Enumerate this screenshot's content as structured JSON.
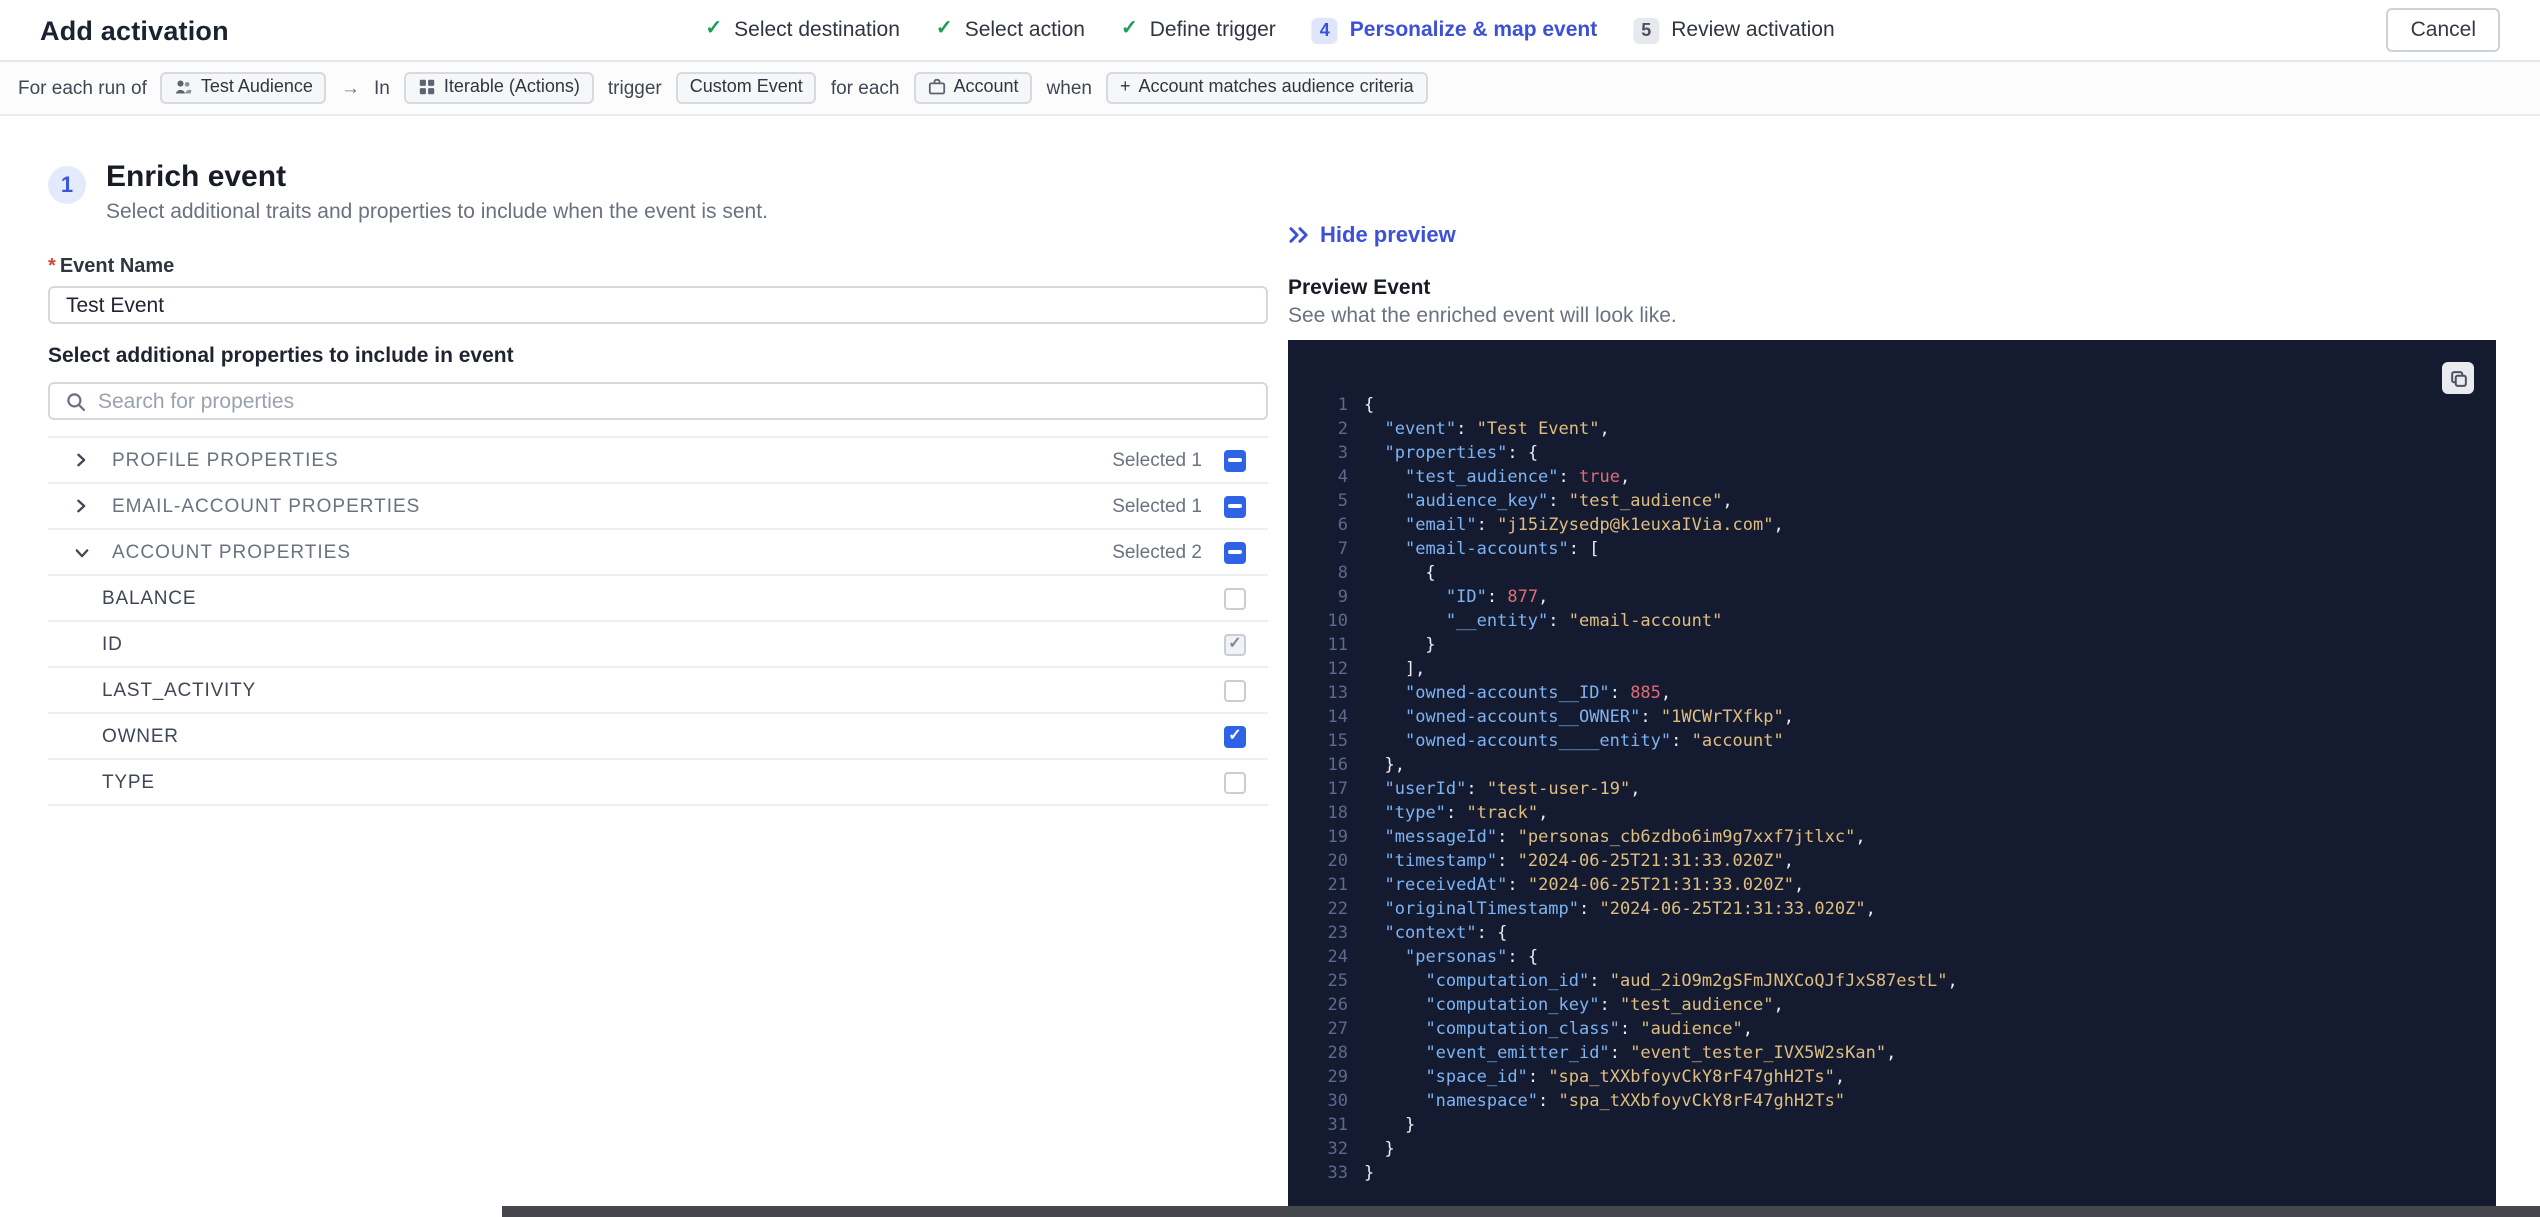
{
  "header": {
    "title": "Add activation",
    "cancel_label": "Cancel",
    "steps": [
      {
        "label": "Select destination",
        "state": "done"
      },
      {
        "label": "Select action",
        "state": "done"
      },
      {
        "label": "Define trigger",
        "state": "done"
      },
      {
        "label": "Personalize & map event",
        "state": "active",
        "number": "4"
      },
      {
        "label": "Review activation",
        "state": "upcoming",
        "number": "5"
      }
    ]
  },
  "context_bar": {
    "prefix": "For each run of",
    "audience_pill": "Test Audience",
    "arrow": "→",
    "in_label": "In",
    "destination_pill": "Iterable (Actions)",
    "trigger_label": "trigger",
    "trigger_pill": "Custom Event",
    "for_each_label": "for each",
    "entity_pill": "Account",
    "when_label": "when",
    "criteria_pill": "Account matches audience criteria"
  },
  "enrich": {
    "step_number": "1",
    "title": "Enrich event",
    "subtitle": "Select additional traits and properties to include when the event is sent.",
    "event_name_label": "Event Name",
    "event_name_value": "Test Event",
    "properties_label": "Select additional properties to include in event",
    "search_placeholder": "Search for properties",
    "sections": [
      {
        "label": "PROFILE PROPERTIES",
        "selected": "Selected 1",
        "expanded": false,
        "checkbox": "indeterminate"
      },
      {
        "label": "EMAIL-ACCOUNT PROPERTIES",
        "selected": "Selected 1",
        "expanded": false,
        "checkbox": "indeterminate"
      },
      {
        "label": "ACCOUNT PROPERTIES",
        "selected": "Selected 2",
        "expanded": true,
        "checkbox": "indeterminate"
      }
    ],
    "account_properties": [
      {
        "label": "BALANCE",
        "checked": false,
        "disabled": false
      },
      {
        "label": "ID",
        "checked": true,
        "disabled": true
      },
      {
        "label": "LAST_ACTIVITY",
        "checked": false,
        "disabled": false
      },
      {
        "label": "OWNER",
        "checked": true,
        "disabled": false
      },
      {
        "label": "TYPE",
        "checked": false,
        "disabled": false
      }
    ]
  },
  "preview": {
    "hide_label": "Hide preview",
    "title": "Preview Event",
    "subtitle": "See what the enriched event will look like.",
    "code_lines": [
      [
        [
          "p",
          "{"
        ]
      ],
      [
        [
          "p",
          "  "
        ],
        [
          "k",
          "\"event\""
        ],
        [
          "p",
          ": "
        ],
        [
          "s",
          "\"Test Event\""
        ],
        [
          "p",
          ","
        ]
      ],
      [
        [
          "p",
          "  "
        ],
        [
          "k",
          "\"properties\""
        ],
        [
          "p",
          ": {"
        ]
      ],
      [
        [
          "p",
          "    "
        ],
        [
          "k",
          "\"test_audience\""
        ],
        [
          "p",
          ": "
        ],
        [
          "b",
          "true"
        ],
        [
          "p",
          ","
        ]
      ],
      [
        [
          "p",
          "    "
        ],
        [
          "k",
          "\"audience_key\""
        ],
        [
          "p",
          ": "
        ],
        [
          "s",
          "\"test_audience\""
        ],
        [
          "p",
          ","
        ]
      ],
      [
        [
          "p",
          "    "
        ],
        [
          "k",
          "\"email\""
        ],
        [
          "p",
          ": "
        ],
        [
          "s",
          "\"j15iZysedp@k1euxaIVia.com\""
        ],
        [
          "p",
          ","
        ]
      ],
      [
        [
          "p",
          "    "
        ],
        [
          "k",
          "\"email-accounts\""
        ],
        [
          "p",
          ": ["
        ]
      ],
      [
        [
          "p",
          "      {"
        ]
      ],
      [
        [
          "p",
          "        "
        ],
        [
          "k",
          "\"ID\""
        ],
        [
          "p",
          ": "
        ],
        [
          "n",
          "877"
        ],
        [
          "p",
          ","
        ]
      ],
      [
        [
          "p",
          "        "
        ],
        [
          "k",
          "\"__entity\""
        ],
        [
          "p",
          ": "
        ],
        [
          "s",
          "\"email-account\""
        ]
      ],
      [
        [
          "p",
          "      }"
        ]
      ],
      [
        [
          "p",
          "    ],"
        ]
      ],
      [
        [
          "p",
          "    "
        ],
        [
          "k",
          "\"owned-accounts__ID\""
        ],
        [
          "p",
          ": "
        ],
        [
          "n",
          "885"
        ],
        [
          "p",
          ","
        ]
      ],
      [
        [
          "p",
          "    "
        ],
        [
          "k",
          "\"owned-accounts__OWNER\""
        ],
        [
          "p",
          ": "
        ],
        [
          "s",
          "\"1WCWrTXfkp\""
        ],
        [
          "p",
          ","
        ]
      ],
      [
        [
          "p",
          "    "
        ],
        [
          "k",
          "\"owned-accounts____entity\""
        ],
        [
          "p",
          ": "
        ],
        [
          "s",
          "\"account\""
        ]
      ],
      [
        [
          "p",
          "  },"
        ]
      ],
      [
        [
          "p",
          "  "
        ],
        [
          "k",
          "\"userId\""
        ],
        [
          "p",
          ": "
        ],
        [
          "s",
          "\"test-user-19\""
        ],
        [
          "p",
          ","
        ]
      ],
      [
        [
          "p",
          "  "
        ],
        [
          "k",
          "\"type\""
        ],
        [
          "p",
          ": "
        ],
        [
          "s",
          "\"track\""
        ],
        [
          "p",
          ","
        ]
      ],
      [
        [
          "p",
          "  "
        ],
        [
          "k",
          "\"messageId\""
        ],
        [
          "p",
          ": "
        ],
        [
          "s",
          "\"personas_cb6zdbo6im9g7xxf7jtlxc\""
        ],
        [
          "p",
          ","
        ]
      ],
      [
        [
          "p",
          "  "
        ],
        [
          "k",
          "\"timestamp\""
        ],
        [
          "p",
          ": "
        ],
        [
          "s",
          "\"2024-06-25T21:31:33.020Z\""
        ],
        [
          "p",
          ","
        ]
      ],
      [
        [
          "p",
          "  "
        ],
        [
          "k",
          "\"receivedAt\""
        ],
        [
          "p",
          ": "
        ],
        [
          "s",
          "\"2024-06-25T21:31:33.020Z\""
        ],
        [
          "p",
          ","
        ]
      ],
      [
        [
          "p",
          "  "
        ],
        [
          "k",
          "\"originalTimestamp\""
        ],
        [
          "p",
          ": "
        ],
        [
          "s",
          "\"2024-06-25T21:31:33.020Z\""
        ],
        [
          "p",
          ","
        ]
      ],
      [
        [
          "p",
          "  "
        ],
        [
          "k",
          "\"context\""
        ],
        [
          "p",
          ": {"
        ]
      ],
      [
        [
          "p",
          "    "
        ],
        [
          "k",
          "\"personas\""
        ],
        [
          "p",
          ": {"
        ]
      ],
      [
        [
          "p",
          "      "
        ],
        [
          "k",
          "\"computation_id\""
        ],
        [
          "p",
          ": "
        ],
        [
          "s",
          "\"aud_2iO9m2gSFmJNXCoQJfJxS87estL\""
        ],
        [
          "p",
          ","
        ]
      ],
      [
        [
          "p",
          "      "
        ],
        [
          "k",
          "\"computation_key\""
        ],
        [
          "p",
          ": "
        ],
        [
          "s",
          "\"test_audience\""
        ],
        [
          "p",
          ","
        ]
      ],
      [
        [
          "p",
          "      "
        ],
        [
          "k",
          "\"computation_class\""
        ],
        [
          "p",
          ": "
        ],
        [
          "s",
          "\"audience\""
        ],
        [
          "p",
          ","
        ]
      ],
      [
        [
          "p",
          "      "
        ],
        [
          "k",
          "\"event_emitter_id\""
        ],
        [
          "p",
          ": "
        ],
        [
          "s",
          "\"event_tester_IVX5W2sKan\""
        ],
        [
          "p",
          ","
        ]
      ],
      [
        [
          "p",
          "      "
        ],
        [
          "k",
          "\"space_id\""
        ],
        [
          "p",
          ": "
        ],
        [
          "s",
          "\"spa_tXXbfoyvCkY8rF47ghH2Ts\""
        ],
        [
          "p",
          ","
        ]
      ],
      [
        [
          "p",
          "      "
        ],
        [
          "k",
          "\"namespace\""
        ],
        [
          "p",
          ": "
        ],
        [
          "s",
          "\"spa_tXXbfoyvCkY8rF47ghH2Ts\""
        ]
      ],
      [
        [
          "p",
          "    }"
        ]
      ],
      [
        [
          "p",
          "  }"
        ]
      ],
      [
        [
          "p",
          "}"
        ]
      ]
    ]
  },
  "icons": {
    "step_done_check": "✓",
    "context_arrow": "→",
    "criteria_plus": "+",
    "checkbox_check": "✓"
  },
  "colors": {
    "accent_blue": "#3c50d8",
    "checkbox_blue": "#2e63e6",
    "success_green": "#18a058",
    "code_background": "#141b30",
    "code_key": "#7db3f2",
    "code_string": "#dfbe7f",
    "code_number": "#e06c75",
    "code_boolean": "#e06c75"
  }
}
